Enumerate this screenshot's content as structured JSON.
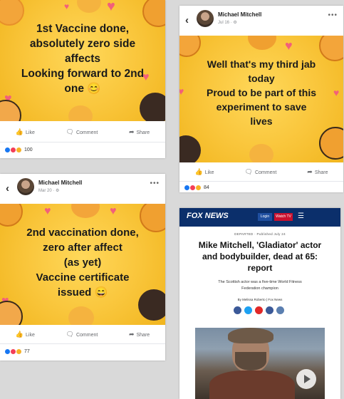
{
  "post1": {
    "text_lines": [
      "1st Vaccine done,",
      "absolutely zero side",
      "affects",
      "Looking forward to 2nd",
      "one 😊"
    ],
    "actions": {
      "like": "Like",
      "comment": "Comment",
      "share": "Share"
    },
    "reaction_count": "100"
  },
  "post2": {
    "author": "Michael Mitchell",
    "date": "Jul 16 · ⚙",
    "text_lines": [
      "Well that's my third jab",
      "today",
      "Proud to be part of this",
      "experiment to save",
      "lives"
    ],
    "actions": {
      "like": "Like",
      "comment": "Comment",
      "share": "Share"
    },
    "reaction_count": "84"
  },
  "post3": {
    "author": "Michael Mitchell",
    "date": "Mar 20 · ⚙",
    "text_lines": [
      "2nd vaccination done,",
      "zero after affect",
      "(as yet)",
      "Vaccine certificate",
      "issued 😄"
    ],
    "actions": {
      "like": "Like",
      "comment": "Comment",
      "share": "Share"
    },
    "reaction_count": "77"
  },
  "fox": {
    "logo": "FOX NEWS",
    "login": "Login",
    "watch": "Watch TV",
    "meta": "DEPARTED  ·  Published July 24",
    "headline_lines": [
      "Mike Mitchell, 'Gladiator' actor",
      "and bodybuilder, dead at 65:",
      "report"
    ],
    "subhead_lines": [
      "The Scottish actor was a five-time World Fitness",
      "Federation champion"
    ],
    "byline": "By Melissa Roberto | Fox News"
  },
  "colors": {
    "like_blue": "#1877f2",
    "love_red": "#f33e58",
    "haha_yellow": "#f7b125",
    "fox_navy": "#0b2f6b",
    "fox_red": "#c8102e"
  }
}
